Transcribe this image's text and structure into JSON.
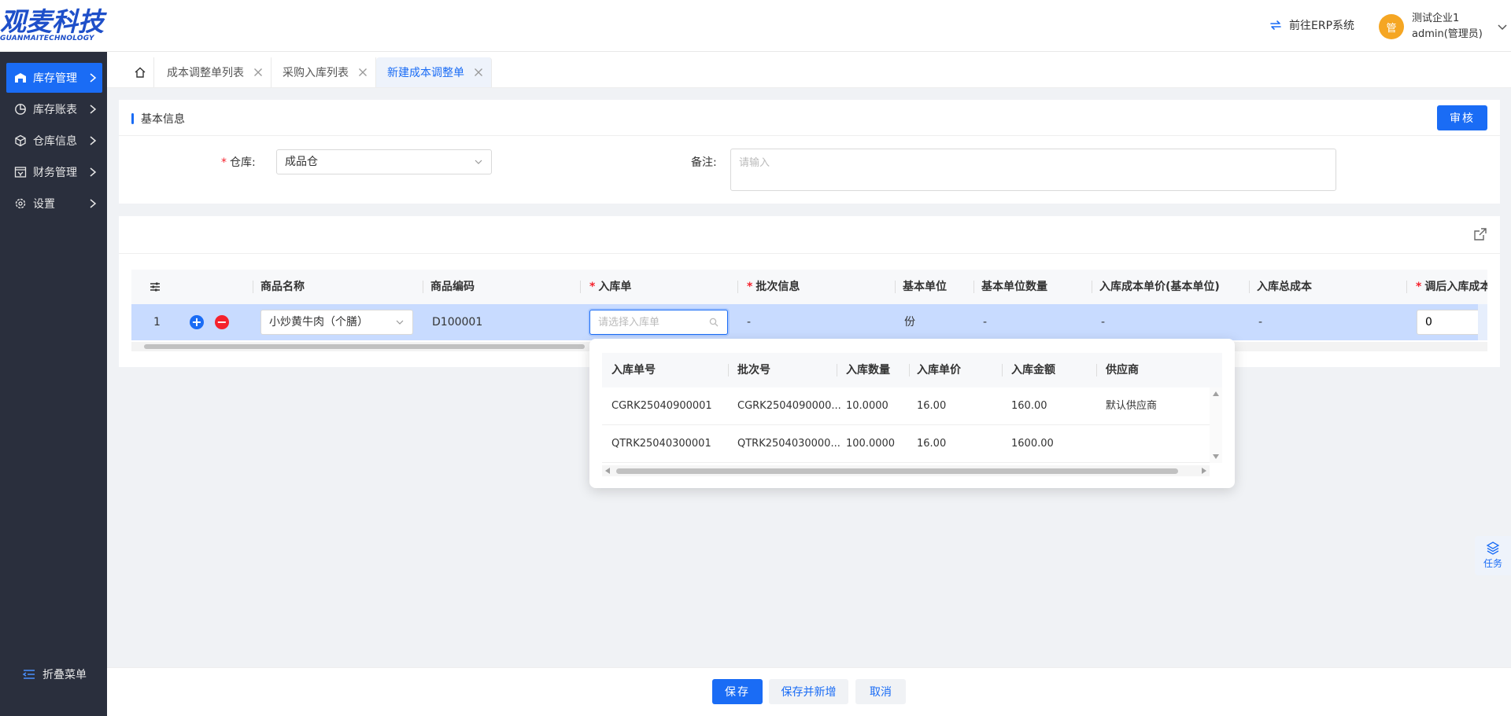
{
  "brand": {
    "name": "观麦科技",
    "subtitle": "GUANMAITECHNOLOGY",
    "color": "#1e4fc9"
  },
  "header": {
    "erp_link": "前往ERP系统",
    "user": {
      "avatar": "管",
      "company": "测试企业1",
      "role": "admin(管理员)"
    }
  },
  "sidebar": {
    "items": [
      {
        "label": "库存管理",
        "icon": "warehouse-icon",
        "active": true
      },
      {
        "label": "库存账表",
        "icon": "pie-chart-icon"
      },
      {
        "label": "仓库信息",
        "icon": "cube-icon"
      },
      {
        "label": "财务管理",
        "icon": "finance-icon"
      },
      {
        "label": "设置",
        "icon": "gear-icon"
      }
    ],
    "collapse_label": "折叠菜单"
  },
  "tabs": [
    {
      "label": "成本调整单列表"
    },
    {
      "label": "采购入库列表"
    },
    {
      "label": "新建成本调整单",
      "active": true
    }
  ],
  "basic_info": {
    "title": "基本信息",
    "approve_label": "审核",
    "warehouse_label": "仓库:",
    "warehouse_value": "成品仓",
    "remark_label": "备注:",
    "remark_placeholder": "请输入"
  },
  "goods_table": {
    "columns": [
      "商品名称",
      "商品编码",
      "入库单",
      "批次信息",
      "基本单位",
      "基本单位数量",
      "入库成本单价(基本单位)",
      "入库总成本",
      "调后入库成本"
    ],
    "row": {
      "index": "1",
      "add": "+",
      "remove": "−",
      "name": "小炒黄牛肉（个膳）",
      "code": "D100001",
      "receipt_placeholder": "请选择入库单",
      "batch": "-",
      "unit": "份",
      "unit_qty": "-",
      "unit_cost": "-",
      "total_cost": "-",
      "adjusted_cost": "0"
    }
  },
  "receipt_popup": {
    "columns": [
      "入库单号",
      "批次号",
      "入库数量",
      "入库单价",
      "入库金额",
      "供应商"
    ],
    "rows": [
      {
        "no": "CGRK25040900001",
        "batch": "CGRK2504090000...",
        "qty": "10.0000",
        "price": "16.00",
        "amount": "160.00",
        "supplier": "默认供应商"
      },
      {
        "no": "QTRK25040300001",
        "batch": "QTRK2504030000...",
        "qty": "100.0000",
        "price": "16.00",
        "amount": "1600.00",
        "supplier": ""
      }
    ]
  },
  "task_label": "任务",
  "footer": {
    "save": "保存",
    "save_new": "保存并新增",
    "cancel": "取消"
  }
}
